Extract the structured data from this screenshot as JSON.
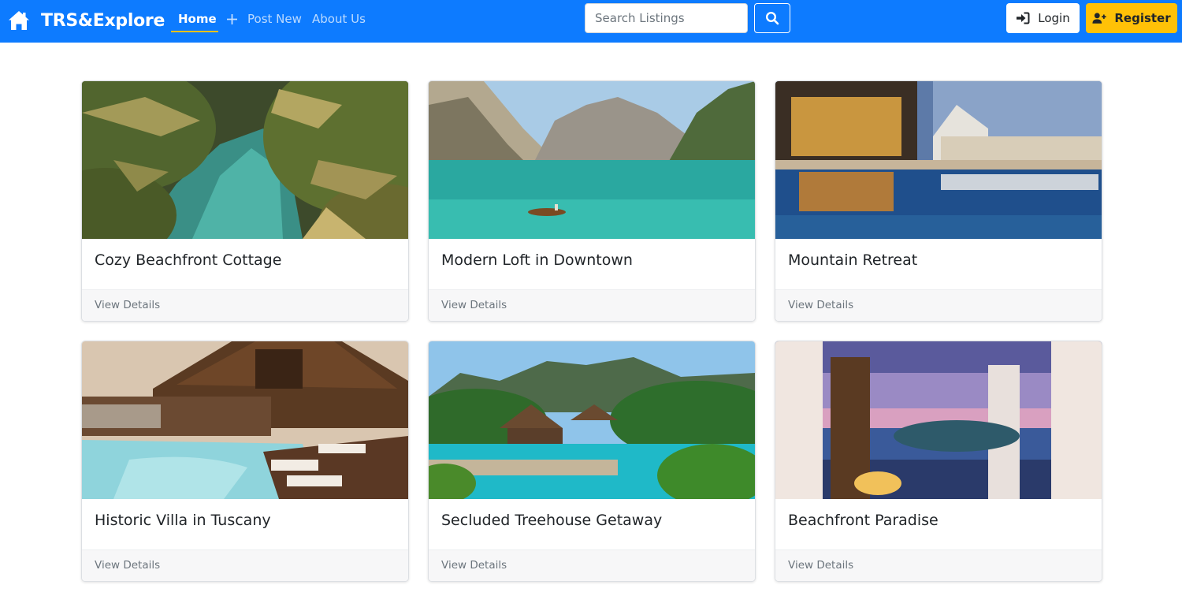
{
  "navbar": {
    "brand": "TRS&Explore",
    "links": [
      {
        "label": "Home"
      },
      {
        "label": "Post New"
      },
      {
        "label": "About Us"
      }
    ],
    "search": {
      "placeholder": "Search Listings"
    },
    "login_label": "Login",
    "register_label": "Register"
  },
  "colors": {
    "accent": "#0d7bff",
    "highlight": "#ffc107"
  },
  "listings": [
    {
      "title": "Cozy Beachfront Cottage",
      "footer": "View Details"
    },
    {
      "title": "Modern Loft in Downtown",
      "footer": "View Details"
    },
    {
      "title": "Mountain Retreat",
      "footer": "View Details"
    },
    {
      "title": "Historic Villa in Tuscany",
      "footer": "View Details"
    },
    {
      "title": "Secluded Treehouse Getaway",
      "footer": "View Details"
    },
    {
      "title": "Beachfront Paradise",
      "footer": "View Details"
    }
  ]
}
